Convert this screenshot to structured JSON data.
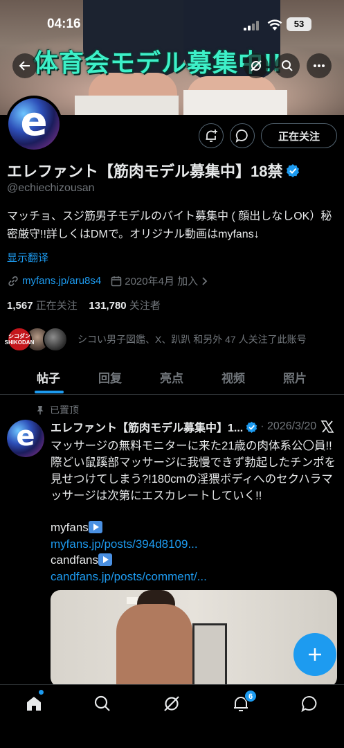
{
  "status_bar": {
    "time": "04:16",
    "battery": "53"
  },
  "banner": {
    "title": "体育会モデル募集中!!"
  },
  "profile": {
    "name": "エレファント【筋肉モデル募集中】18禁",
    "handle": "@echiechizousan",
    "bio": "マッチョ、スジ筋男子モデルのバイト募集中 ( 顔出しなしOK）秘密厳守!!詳しくはDMで。オリジナル動画はmyfans↓",
    "translate": "显示翻译",
    "link": "myfans.jp/aru8s4",
    "joined": "2020年4月 加入",
    "following_count": "1,567",
    "following_label": "正在关注",
    "followers_count": "131,780",
    "followers_label": "关注者",
    "followed_by": "シコい男子図鑑、X、趴趴 和另外 47 人关注了此账号",
    "follow_button": "正在关注",
    "avatar_letter": "e",
    "mini_avatar_label": "シコダン\nSHIKODAN"
  },
  "tabs": [
    "帖子",
    "回复",
    "亮点",
    "视频",
    "照片"
  ],
  "post": {
    "pinned_label": "已置顶",
    "author": "エレファント【筋肉モデル募集中】1...",
    "date": "· 2026/3/20",
    "text": "マッサージの無料モニターに来た21歳の肉体系公〇員!!際どい鼠蹊部マッサージに我慢できず勃起したチンポを見せつけてしまう?!180cmの淫猥ボディへのセクハラマッサージは次第にエスカレートしていく!!",
    "line1": "myfans",
    "link1": "myfans.jp/posts/394d8109...",
    "line2": "candfans",
    "link2": "candfans.jp/posts/comment/..."
  },
  "nav": {
    "notifications_badge": "6"
  },
  "colors": {
    "accent": "#1d9bf0",
    "banner_text": "#3df0c8"
  }
}
